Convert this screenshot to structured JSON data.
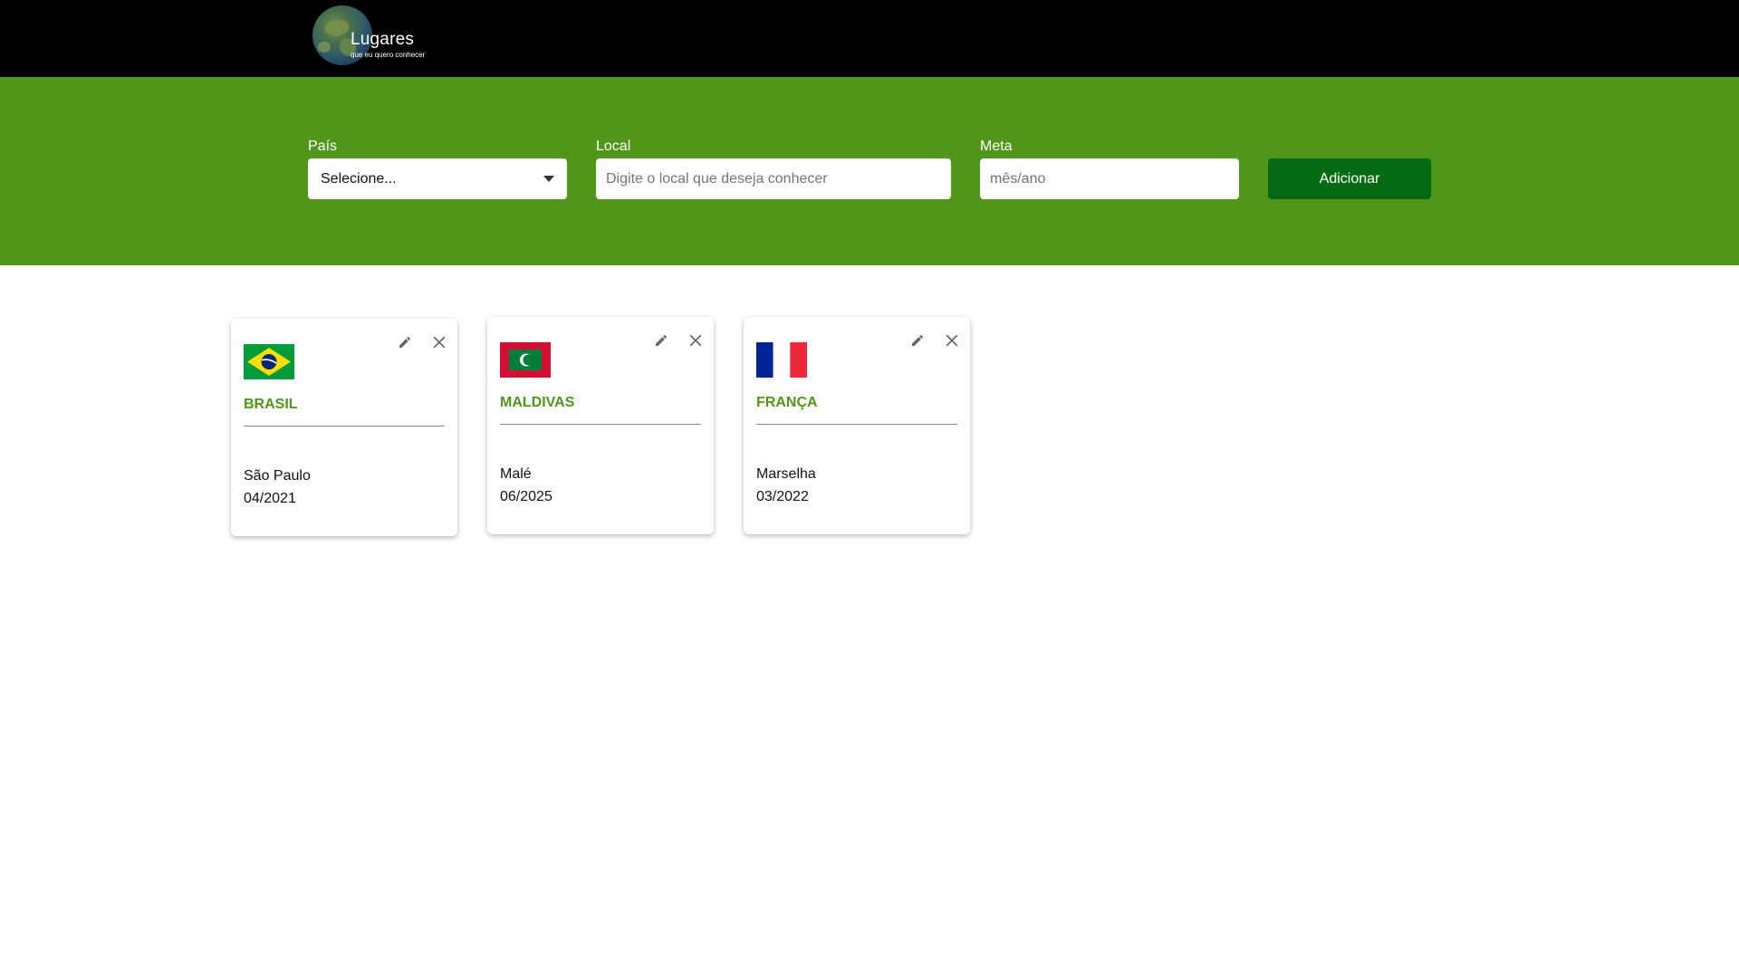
{
  "header": {
    "logo_title": "Lugares",
    "logo_subtitle": "que eu quero conhecer"
  },
  "form": {
    "country": {
      "label": "País",
      "value": "Selecione..."
    },
    "place": {
      "label": "Local",
      "placeholder": "Digite o local que deseja conhecer"
    },
    "goal": {
      "label": "Meta",
      "placeholder": "mês/ano"
    },
    "submit_label": "Adicionar"
  },
  "cards": [
    {
      "country": "BRASIL",
      "place": "São Paulo",
      "date": "04/2021",
      "flag": "brazil-flag"
    },
    {
      "country": "MALDIVAS",
      "place": "Malé",
      "date": "06/2025",
      "flag": "maldives-flag"
    },
    {
      "country": "FRANÇA",
      "place": "Marselha",
      "date": "03/2022",
      "flag": "france-flag"
    }
  ],
  "icons": {
    "edit": "pencil-icon",
    "delete": "close-icon",
    "dropdown": "caret-down-icon"
  },
  "colors": {
    "header_bg": "#000000",
    "band_bg": "#51951a",
    "button_bg": "#046b14",
    "country_text": "#51951a"
  }
}
